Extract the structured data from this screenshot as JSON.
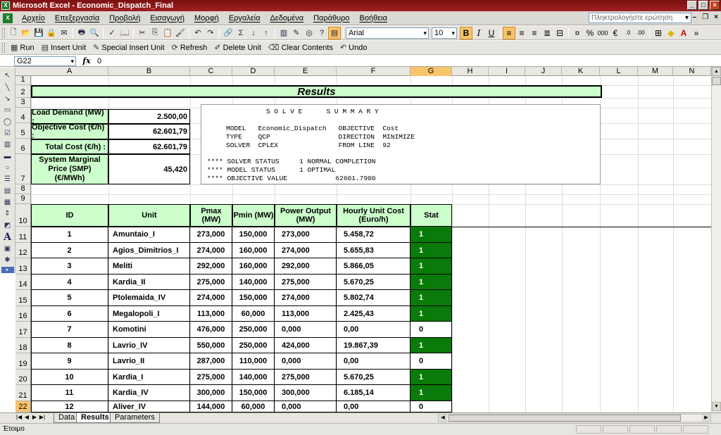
{
  "window": {
    "title": "Microsoft Excel - Economic_Dispatch_Final"
  },
  "menu": {
    "items": [
      "Αρχείο",
      "Επεξεργασία",
      "Προβολή",
      "Εισαγωγή",
      "Μορφή",
      "Εργαλεία",
      "Δεδομένα",
      "Παράθυρο",
      "Βοήθεια"
    ],
    "ask_placeholder": "Πληκτρολογήστε ερώτηση"
  },
  "format_toolbar": {
    "font": "Arial",
    "size": "10"
  },
  "macro_toolbar": {
    "run": "Run",
    "insert_unit": "Insert Unit",
    "special_insert_unit": "Special Insert Unit",
    "refresh": "Refresh",
    "delete_unit": "Delete Unit",
    "clear_contents": "Clear Contents",
    "undo": "Undo"
  },
  "formula_bar": {
    "name_box": "G22",
    "value": "0"
  },
  "columns": [
    "A",
    "B",
    "C",
    "D",
    "E",
    "F",
    "G",
    "H",
    "I",
    "J",
    "K",
    "L",
    "M",
    "N"
  ],
  "rows": [
    "1",
    "2",
    "3",
    "4",
    "5",
    "6",
    "7",
    "8",
    "9",
    "10",
    "11",
    "12",
    "13",
    "14",
    "15",
    "16",
    "17",
    "18",
    "19",
    "20",
    "21",
    "22"
  ],
  "sheet": {
    "title": "Results",
    "summary_block": [
      {
        "label": "Load Demand (MW) :",
        "value": "2.500,00"
      },
      {
        "label": "Objective Cost (€/h) :",
        "value": "62.601,79"
      },
      {
        "label": "Total Cost (€/h) :",
        "value": "62.601,79"
      },
      {
        "label": "System Marginal Price (SMP) (€/MWh)",
        "value": "45,420"
      }
    ],
    "solve_summary": {
      "heading": "S O L V E      S U M M A R Y",
      "lines": [
        "MODEL   Economic_Dispatch   OBJECTIVE  Cost",
        "TYPE    QCP                 DIRECTION  MINIMIZE",
        "SOLVER  CPLEX               FROM LINE  92",
        "**** SOLVER STATUS     1 NORMAL COMPLETION",
        "**** MODEL STATUS      1 OPTIMAL",
        "**** OBJECTIVE VALUE            62601.7900"
      ]
    },
    "table": {
      "headers": [
        "ID",
        "Unit",
        "Pmax (MW)",
        "Pmin (MW)",
        "Power Output (MW)",
        "Hourly Unit Cost (Euro/h)",
        "Stat"
      ],
      "rows": [
        [
          "1",
          "Amuntaio_I",
          "273,000",
          "150,000",
          "273,000",
          "5.458,72",
          "1"
        ],
        [
          "2",
          "Agios_Dimitrios_I",
          "274,000",
          "160,000",
          "274,000",
          "5.655,83",
          "1"
        ],
        [
          "3",
          "Meliti",
          "292,000",
          "160,000",
          "292,000",
          "5.866,05",
          "1"
        ],
        [
          "4",
          "Kardia_II",
          "275,000",
          "140,000",
          "275,000",
          "5.670,25",
          "1"
        ],
        [
          "5",
          "Ptolemaida_IV",
          "274,000",
          "150,000",
          "274,000",
          "5.802,74",
          "1"
        ],
        [
          "6",
          "Megalopoli_I",
          "113,000",
          "60,000",
          "113,000",
          "2.425,43",
          "1"
        ],
        [
          "7",
          "Komotini",
          "476,000",
          "250,000",
          "0,000",
          "0,00",
          "0"
        ],
        [
          "8",
          "Lavrio_IV",
          "550,000",
          "250,000",
          "424,000",
          "19.867,39",
          "1"
        ],
        [
          "9",
          "Lavrio_II",
          "287,000",
          "110,000",
          "0,000",
          "0,00",
          "0"
        ],
        [
          "10",
          "Kardia_I",
          "275,000",
          "140,000",
          "275,000",
          "5.670,25",
          "1"
        ],
        [
          "11",
          "Kardia_IV",
          "300,000",
          "150,000",
          "300,000",
          "6.185,14",
          "1"
        ],
        [
          "12",
          "Aliver_IV",
          "144,000",
          "60,000",
          "0,000",
          "0,00",
          "0"
        ]
      ]
    }
  },
  "sheet_tabs": [
    "Data",
    "Results",
    "Parameters"
  ],
  "active_tab": "Results",
  "status": "Έτοιμο",
  "colors": {
    "green_fill": "#ccffcc",
    "stat_on": "#0a7a0a",
    "title_bar": "#8b1515"
  }
}
